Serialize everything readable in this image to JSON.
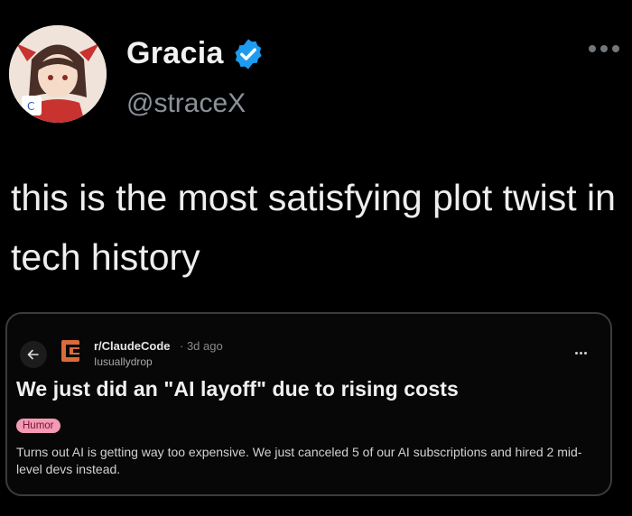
{
  "author": {
    "display_name": "Gracia",
    "handle": "@straceX",
    "verified": true,
    "avatar_icon": "anime-character-avatar"
  },
  "tweet": {
    "text": "this is the most satisfying plot twist in tech history"
  },
  "embedded_post": {
    "subreddit": "r/ClaudeCode",
    "time_ago": "· 3d ago",
    "username": "Iusuallydrop",
    "title": "We just did an \"AI layoff\" due to rising costs",
    "flair": "Humor",
    "body": "Turns out AI is getting way too expensive. We just canceled 5 of our AI subscriptions and hired 2 mid-level devs instead."
  },
  "icons": {
    "more": "more-horizontal-icon",
    "back": "arrow-left-icon",
    "verified": "verified-badge-icon",
    "subreddit": "claude-code-logo-icon"
  },
  "colors": {
    "background": "#000000",
    "verified_blue": "#1d9bf0",
    "flair_pink": "#f39ab4",
    "subreddit_logo": "#d96b3a"
  }
}
